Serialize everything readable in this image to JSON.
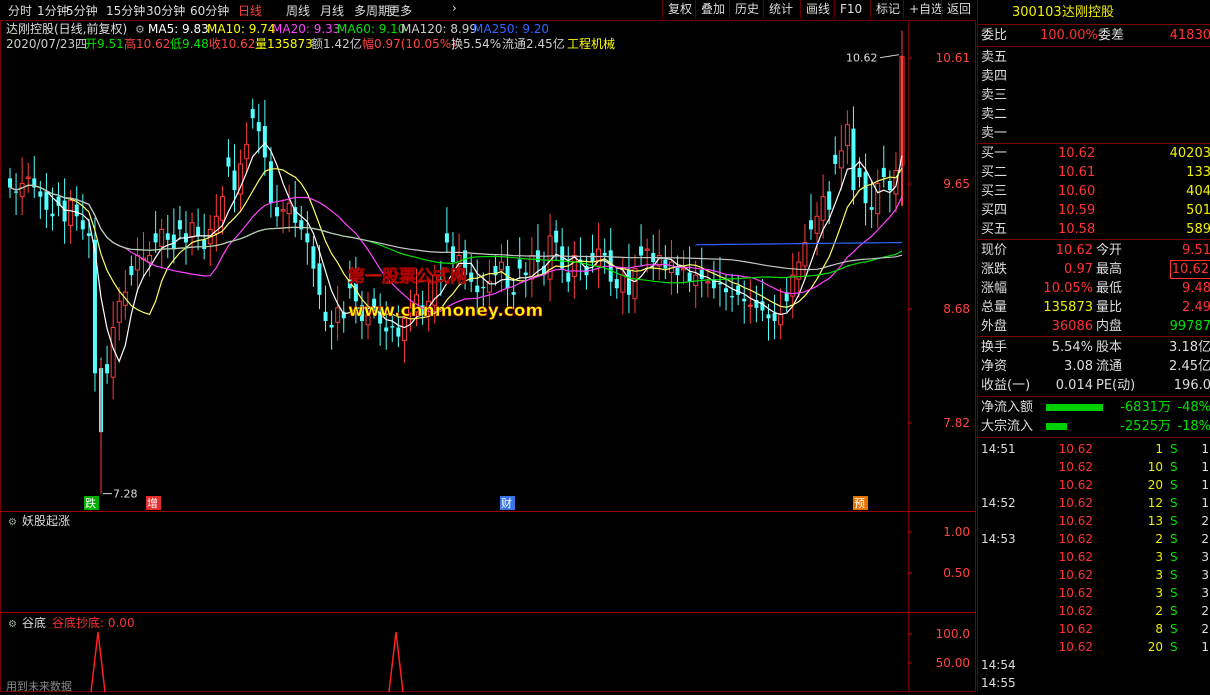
{
  "toolbar": {
    "periods": [
      "分时",
      "1分钟",
      "5分钟",
      "15分钟",
      "30分钟",
      "60分钟",
      "日线",
      "周线",
      "月线",
      "多周期",
      "更多"
    ],
    "active_period": "日线",
    "buttons": [
      "复权",
      "叠加",
      "历史",
      "统计",
      "画线",
      "F10",
      "标记",
      "+自选",
      "返回"
    ]
  },
  "chart_header": {
    "name": "达刚控股(日线,前复权)",
    "ma": [
      {
        "label": "MA5: 9.83",
        "color": "#ffffff"
      },
      {
        "label": "MA10: 9.74",
        "color": "#ffff00"
      },
      {
        "label": "MA20: 9.33",
        "color": "#ff44ff"
      },
      {
        "label": "MA60: 9.10",
        "color": "#00e000"
      },
      {
        "label": "MA120: 8.99",
        "color": "#cccccc"
      },
      {
        "label": "MA250: 9.20",
        "color": "#3366ff"
      }
    ],
    "info": [
      {
        "t": "2020/07/23四",
        "c": "#cccccc"
      },
      {
        "t": "开9.51",
        "c": "#00e000"
      },
      {
        "t": "高10.62",
        "c": "#ff4444"
      },
      {
        "t": "低9.48",
        "c": "#00e000"
      },
      {
        "t": "收10.62",
        "c": "#ff4444"
      },
      {
        "t": "量135873",
        "c": "#ffff00"
      },
      {
        "t": "额1.42亿",
        "c": "#cccccc"
      },
      {
        "t": "幅0.97(10.05%)",
        "c": "#ff4444"
      },
      {
        "t": "换5.54%",
        "c": "#cccccc"
      },
      {
        "t": "流通2.45亿",
        "c": "#cccccc"
      },
      {
        "t": "工程机械",
        "c": "#ffff00"
      }
    ]
  },
  "price_axis": [
    "10.61",
    "9.65",
    "8.68",
    "7.82"
  ],
  "chart_labels": {
    "high": "10.62",
    "low": "7.28",
    "markers": [
      "跌",
      "增",
      "财",
      "预"
    ]
  },
  "watermark": {
    "line1": "第一股票公式网",
    "line2": "www.chnmoney.com"
  },
  "indicator1": {
    "name": "妖股起涨",
    "axis": [
      "1.00",
      "0.50"
    ]
  },
  "indicator2": {
    "name": "谷底",
    "line": "谷底抄底: 0.00",
    "axis": [
      "100.0",
      "50.00"
    ]
  },
  "footer_text": "用到未来数据",
  "quote": {
    "code": "300103",
    "name": "达刚控股",
    "weibi_label": "委比",
    "weibi_value": "100.00%",
    "weicha_label": "委差",
    "weicha_value": "41830",
    "sell": [
      {
        "label": "卖五",
        "price": "",
        "vol": ""
      },
      {
        "label": "卖四",
        "price": "",
        "vol": ""
      },
      {
        "label": "卖三",
        "price": "",
        "vol": ""
      },
      {
        "label": "卖二",
        "price": "",
        "vol": ""
      },
      {
        "label": "卖一",
        "price": "",
        "vol": ""
      }
    ],
    "buy": [
      {
        "label": "买一",
        "price": "10.62",
        "vol": "40203"
      },
      {
        "label": "买二",
        "price": "10.61",
        "vol": "133"
      },
      {
        "label": "买三",
        "price": "10.60",
        "vol": "404"
      },
      {
        "label": "买四",
        "price": "10.59",
        "vol": "501"
      },
      {
        "label": "买五",
        "price": "10.58",
        "vol": "589"
      }
    ],
    "stats": [
      {
        "l1": "现价",
        "v1": "10.62",
        "c1": "red",
        "l2": "今开",
        "v2": "9.51",
        "c2": "red"
      },
      {
        "l1": "涨跌",
        "v1": "0.97",
        "c1": "red",
        "l2": "最高",
        "v2": "10.62",
        "c2": "red",
        "box": true
      },
      {
        "l1": "涨幅",
        "v1": "10.05%",
        "c1": "red",
        "l2": "最低",
        "v2": "9.48",
        "c2": "red"
      },
      {
        "l1": "总量",
        "v1": "135873",
        "c1": "yel",
        "l2": "量比",
        "v2": "2.49",
        "c2": "red"
      },
      {
        "l1": "外盘",
        "v1": "36086",
        "c1": "red",
        "l2": "内盘",
        "v2": "99787",
        "c2": "grn"
      }
    ],
    "stats2": [
      {
        "l1": "换手",
        "v1": "5.54%",
        "l2": "股本",
        "v2": "3.18亿"
      },
      {
        "l1": "净资",
        "v1": "3.08",
        "l2": "流通",
        "v2": "2.45亿"
      },
      {
        "l1": "收益(一)",
        "v1": "0.014",
        "l2": "PE(动)",
        "v2": "196.0"
      }
    ],
    "flows": [
      {
        "label": "净流入额",
        "value": "-6831万",
        "pct": "-48%",
        "bar": 0.48
      },
      {
        "label": "大宗流入",
        "value": "-2525万",
        "pct": "-18%",
        "bar": 0.18
      }
    ],
    "ticks": [
      {
        "time": "14:51",
        "price": "10.62",
        "vol": "1",
        "side": "S",
        "n": "1"
      },
      {
        "time": "",
        "price": "10.62",
        "vol": "10",
        "side": "S",
        "n": "1"
      },
      {
        "time": "",
        "price": "10.62",
        "vol": "20",
        "side": "S",
        "n": "1"
      },
      {
        "time": "14:52",
        "price": "10.62",
        "vol": "12",
        "side": "S",
        "n": "1"
      },
      {
        "time": "",
        "price": "10.62",
        "vol": "13",
        "side": "S",
        "n": "2"
      },
      {
        "time": "14:53",
        "price": "10.62",
        "vol": "2",
        "side": "S",
        "n": "2"
      },
      {
        "time": "",
        "price": "10.62",
        "vol": "3",
        "side": "S",
        "n": "3"
      },
      {
        "time": "",
        "price": "10.62",
        "vol": "3",
        "side": "S",
        "n": "3"
      },
      {
        "time": "",
        "price": "10.62",
        "vol": "3",
        "side": "S",
        "n": "3"
      },
      {
        "time": "",
        "price": "10.62",
        "vol": "2",
        "side": "S",
        "n": "2"
      },
      {
        "time": "",
        "price": "10.62",
        "vol": "8",
        "side": "S",
        "n": "2"
      },
      {
        "time": "",
        "price": "10.62",
        "vol": "20",
        "side": "S",
        "n": "1"
      },
      {
        "time": "14:54",
        "price": "",
        "vol": "",
        "side": "",
        "n": ""
      },
      {
        "time": "14:55",
        "price": "",
        "vol": "",
        "side": "",
        "n": ""
      }
    ]
  }
}
